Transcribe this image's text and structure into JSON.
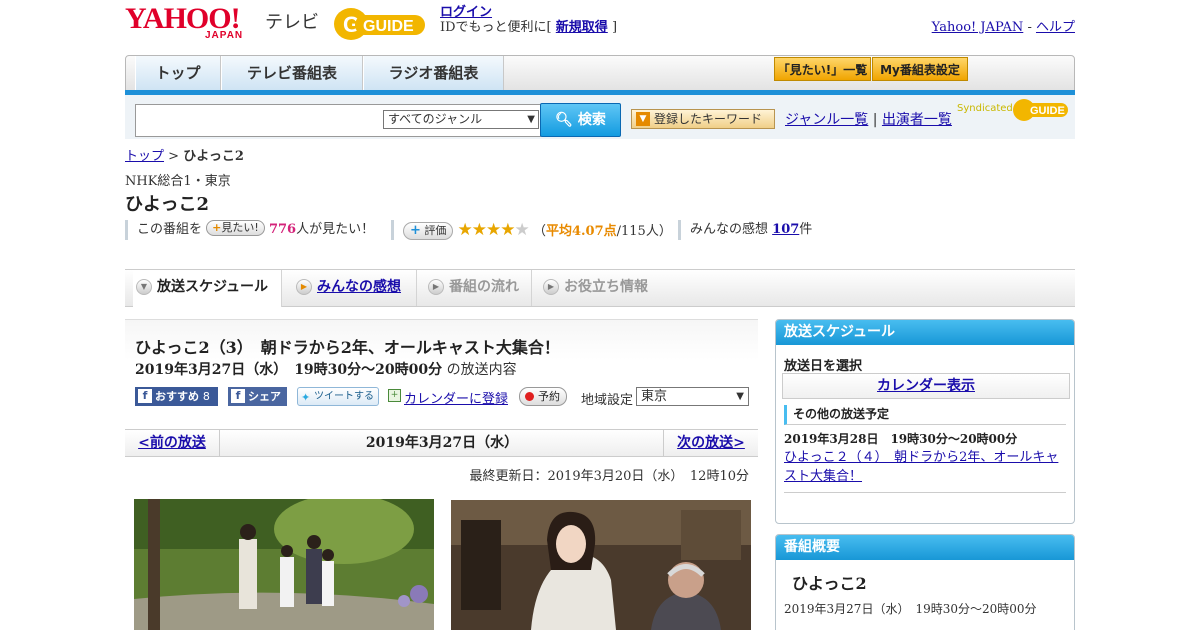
{
  "header": {
    "yahoo_logo": "YAHOO!",
    "yahoo_logo_sub": "JAPAN",
    "tv_label": "テレビ",
    "gguide_logo": "GUIDE",
    "login_link": "ログイン",
    "login_text": "IDでもっと便利に[",
    "register_link": "新規取得",
    "register_close": "]",
    "yahoo_japan_link": "Yahoo! JAPAN",
    "link_sep": "-",
    "help_link": "ヘルプ"
  },
  "nav": {
    "tabs": [
      "トップ",
      "テレビ番組表",
      "ラジオ番組表"
    ],
    "mitai_list": "「見たい!」一覧",
    "my_schedule": "My番組表設定"
  },
  "search": {
    "placeholder": "",
    "genre_selected": "すべてのジャンル",
    "search_button": "検索",
    "keyword_button": "登録したキーワード",
    "genre_list_link": "ジャンル一覧",
    "sep": "|",
    "performer_list_link": "出演者一覧",
    "syndicated": "Syndicated"
  },
  "breadcrumb": {
    "top": "トップ",
    "sep": ">",
    "current": "ひよっこ2"
  },
  "program": {
    "channel": "NHK総合1・東京",
    "title": "ひよっこ2",
    "mitai_prefix": "この番組を",
    "mitai_button": "見たい!",
    "mitai_count": "776",
    "mitai_suffix": "人が見たい！",
    "rating_button": "評価",
    "rating_stars": 4,
    "rating_avg_open": "（",
    "rating_avg": "平均4.07点",
    "rating_count": "/115人）",
    "impressions_label": "みんなの感想",
    "impressions_count": "107",
    "impressions_unit": "件"
  },
  "tabs": [
    {
      "label": "放送スケジュール",
      "active": true
    },
    {
      "label": "みんなの感想",
      "active": false,
      "link": true
    },
    {
      "label": "番組の流れ",
      "active": false
    },
    {
      "label": "お役立ち情報",
      "active": false
    }
  ],
  "episode": {
    "title": "ひよっこ2（3）　朝ドラから2年、オールキャスト大集合！",
    "datetime": "2019年3月27日（水）　19時30分～20時00分",
    "datetime_suffix": " の放送内容",
    "recommend_label": "おすすめ",
    "recommend_count": "8",
    "share_label": "シェア",
    "tweet_label": "ツイートする",
    "calendar_label": "カレンダーに登録",
    "reserve_label": "予約",
    "region_label": "地域設定",
    "region_selected": "東京"
  },
  "date_nav": {
    "prev": "<前の放送",
    "current": "2019年3月27日（水）",
    "next": "次の放送>"
  },
  "updated": "最終更新日：2019年3月20日（水）　12時10分",
  "sidebar": {
    "schedule_header": "放送スケジュール",
    "select_date_label": "放送日を選択",
    "calendar_button": "カレンダー表示",
    "other_label": "その他の放送予定",
    "other_date": "2019年3月28日　19時30分～20時00分",
    "other_title": "ひよっこ２（４）　朝ドラから2年、オールキャスト大集合！",
    "summary_header": "番組概要",
    "summary_title": "ひよっこ2",
    "summary_time": "2019年3月27日（水）　19時30分～20時00分"
  },
  "colors": {
    "accent_blue": "#1e90d8",
    "brand_red": "#e0002a",
    "rating_orange": "#e88a00",
    "pink": "#d4237a"
  }
}
